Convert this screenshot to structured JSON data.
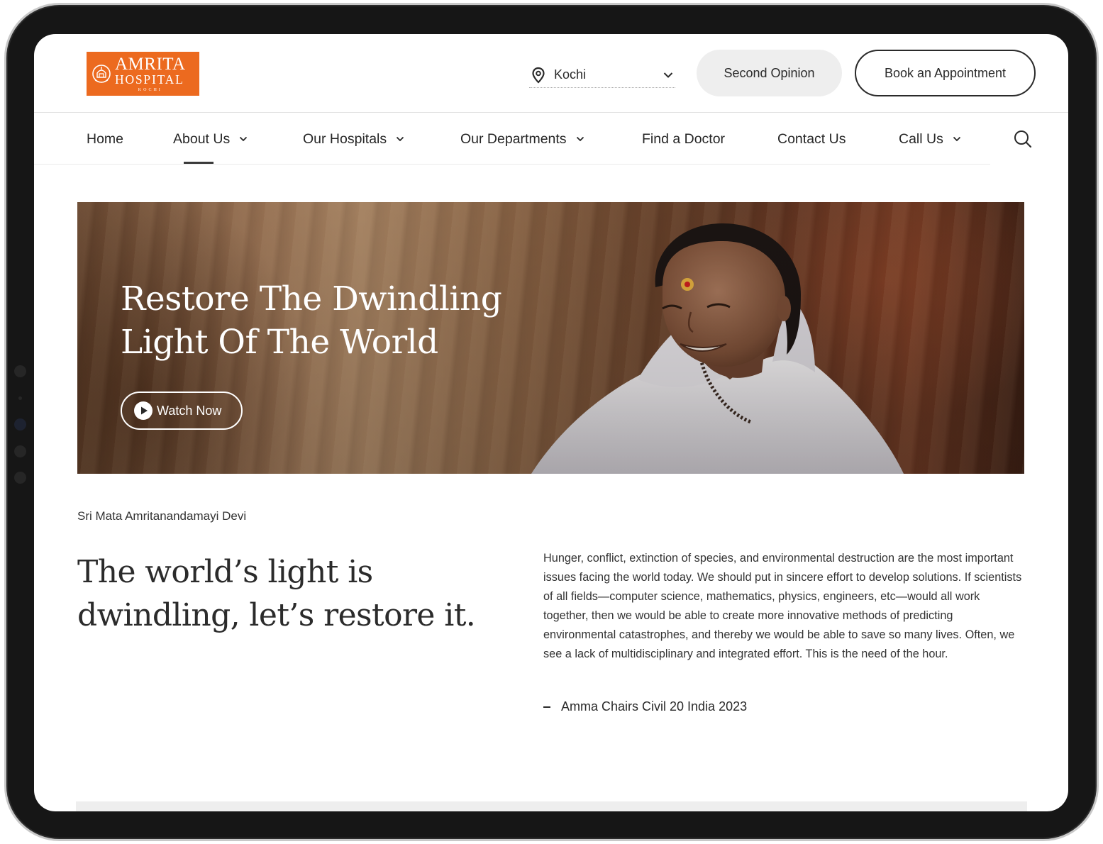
{
  "brand": {
    "name_line1": "AMRITA",
    "name_line2": "HOSPITAL",
    "city": "KOCHI",
    "color": "#ec6a1f"
  },
  "header": {
    "location": {
      "icon": "location-pin-icon",
      "value": "Kochi",
      "dropdown_icon": "chevron-down-icon"
    },
    "second_opinion_label": "Second Opinion",
    "book_appointment_label": "Book an Appointment"
  },
  "nav": {
    "items": [
      {
        "label": "Home",
        "has_dropdown": false
      },
      {
        "label": "About Us",
        "has_dropdown": true,
        "active": true
      },
      {
        "label": "Our Hospitals",
        "has_dropdown": true
      },
      {
        "label": "Our Departments",
        "has_dropdown": true
      },
      {
        "label": "Find a Doctor",
        "has_dropdown": false
      },
      {
        "label": "Contact Us",
        "has_dropdown": false
      },
      {
        "label": "Call Us",
        "has_dropdown": true
      }
    ],
    "search_icon": "search-icon"
  },
  "hero": {
    "title_line1": "Restore The Dwindling",
    "title_line2": "Light Of The World",
    "watch_label": "Watch Now",
    "watch_icon": "play-circle-icon"
  },
  "content": {
    "attribution": "Sri Mata Amritanandamayi Devi",
    "heading_line1": "The world’s light is",
    "heading_line2": "dwindling, let’s restore it.",
    "body": "Hunger, conflict, extinction of species, and environmental destruction are the most important issues facing the world today. We should put in sincere effort to develop solutions. If scientists of all fields—computer science, mathematics, physics, engineers, etc—would all work together, then we would be able to create more innovative methods of predicting environmental catastrophes, and thereby we would be able to save so many lives. Often, we see a lack of multidisciplinary and integrated effort. This is the need of the hour.",
    "source": "Amma Chairs Civil 20 India 2023"
  }
}
